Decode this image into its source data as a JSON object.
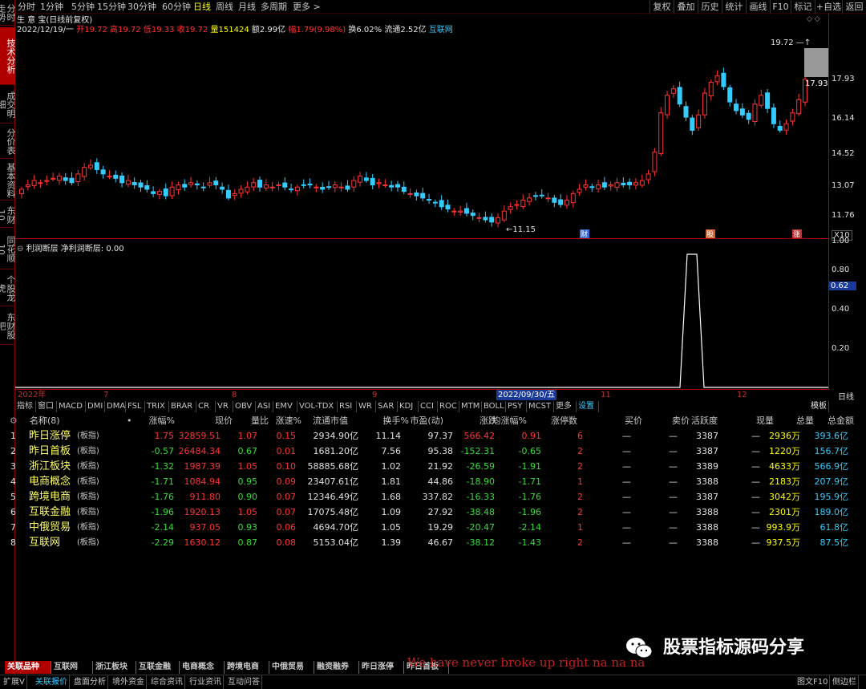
{
  "sidebar": [
    "分时走势",
    "技术分析",
    "成交明细",
    "分价表",
    "基本资料",
    "东财10",
    "同花顺10",
    "个股龙虎",
    "东财股吧"
  ],
  "topbar": {
    "periods": [
      "分时",
      "1分钟",
      "5分钟",
      "15分钟",
      "30分钟",
      "60分钟",
      "日线",
      "周线",
      "月线",
      "多周期",
      "更多 >"
    ],
    "active": "日线",
    "right": [
      "复权",
      "叠加",
      "历史",
      "统计",
      "画线",
      "F10",
      "标记",
      "+自选",
      "返回"
    ]
  },
  "chart_header": {
    "title": "生 意 宝(日线前复权)",
    "date": "2022/12/19/一",
    "open_label": "开19.72",
    "high_label": "高19.72",
    "low_label": "低19.33",
    "close_label": "收19.72",
    "vol_label": "量151424",
    "amt_label": "额2.99亿",
    "chg_label": "幅1.79(9.98%)",
    "turn_label": "换6.02%",
    "float_label": "流通2.52亿",
    "sector": "互联网"
  },
  "price_axis": [
    "17.93",
    "16.14",
    "14.52",
    "13.07",
    "11.76"
  ],
  "price_current": "17.93",
  "price_hi_mark": "19.72",
  "price_lo_mark": "11.15",
  "xscale": "X10",
  "markers": [
    "财",
    "股",
    "涨"
  ],
  "indicator": {
    "title": "利润断层",
    "line_label": "净利润断层: 0.00",
    "axis": [
      "1.00",
      "0.80",
      "0.62",
      "0.40",
      "0.20"
    ],
    "current": "0.62"
  },
  "date_axis": [
    "2022年",
    "7",
    "8",
    "9",
    "2022/09/30/五",
    "11",
    "12"
  ],
  "date_axis_right": "日线",
  "indicator_tabs": [
    "指标",
    "窗口",
    "MACD",
    "DMI",
    "DMA",
    "FSL",
    "TRIX",
    "BRAR",
    "CR",
    "VR",
    "OBV",
    "ASI",
    "EMV",
    "VOL-TDX",
    "RSI",
    "WR",
    "SAR",
    "KDJ",
    "CCI",
    "ROC",
    "MTM",
    "BOLL",
    "PSY",
    "MCST",
    "更多",
    "设置"
  ],
  "indicator_tabs_right": "模板",
  "table": {
    "headers": [
      "名称(8)",
      "•",
      "涨幅%",
      "现价",
      "量比",
      "涨速%",
      "流通市值",
      "换手%",
      "市盈(动)",
      "涨跌",
      "均涨幅%",
      "涨停数",
      "买价",
      "卖价",
      "活跃度",
      "现量",
      "总量",
      "总金额"
    ],
    "rows": [
      {
        "no": "1",
        "name": "昨日涨停",
        "tag": "(板指)",
        "chg": "1.75",
        "price": "32859.51",
        "vr": "1.07",
        "spd": "0.15",
        "mcap": "2934.90亿",
        "turn": "11.14",
        "pe": "97.37",
        "diff": "566.42",
        "avg": "0.91",
        "lim": "6",
        "buy": "—",
        "sell": "—",
        "act": "3387",
        "cur": "—",
        "vol": "2936万",
        "amt": "393.6亿",
        "up": true
      },
      {
        "no": "2",
        "name": "昨日首板",
        "tag": "(板指)",
        "chg": "-0.57",
        "price": "26484.34",
        "vr": "0.67",
        "spd": "0.01",
        "mcap": "1681.20亿",
        "turn": "7.56",
        "pe": "95.38",
        "diff": "-152.31",
        "avg": "-0.65",
        "lim": "2",
        "buy": "—",
        "sell": "—",
        "act": "3387",
        "cur": "—",
        "vol": "1220万",
        "amt": "156.7亿",
        "up": false
      },
      {
        "no": "3",
        "name": "浙江板块",
        "tag": "(板指)",
        "chg": "-1.32",
        "price": "1987.39",
        "vr": "1.05",
        "spd": "0.10",
        "mcap": "58885.68亿",
        "turn": "1.02",
        "pe": "21.92",
        "diff": "-26.59",
        "avg": "-1.91",
        "lim": "2",
        "buy": "—",
        "sell": "—",
        "act": "3389",
        "cur": "—",
        "vol": "4633万",
        "amt": "566.9亿",
        "up": false
      },
      {
        "no": "4",
        "name": "电商概念",
        "tag": "(板指)",
        "chg": "-1.71",
        "price": "1084.94",
        "vr": "0.95",
        "spd": "0.09",
        "mcap": "23407.61亿",
        "turn": "1.81",
        "pe": "44.86",
        "diff": "-18.90",
        "avg": "-1.71",
        "lim": "1",
        "buy": "—",
        "sell": "—",
        "act": "3388",
        "cur": "—",
        "vol": "2183万",
        "amt": "207.9亿",
        "up": false
      },
      {
        "no": "5",
        "name": "跨境电商",
        "tag": "(板指)",
        "chg": "-1.76",
        "price": "911.80",
        "vr": "0.90",
        "spd": "0.07",
        "mcap": "12346.49亿",
        "turn": "1.68",
        "pe": "337.82",
        "diff": "-16.33",
        "avg": "-1.76",
        "lim": "2",
        "buy": "—",
        "sell": "—",
        "act": "3387",
        "cur": "—",
        "vol": "3042万",
        "amt": "195.9亿",
        "up": false
      },
      {
        "no": "6",
        "name": "互联金融",
        "tag": "(板指)",
        "chg": "-1.96",
        "price": "1920.13",
        "vr": "1.05",
        "spd": "0.07",
        "mcap": "17075.48亿",
        "turn": "1.09",
        "pe": "27.92",
        "diff": "-38.48",
        "avg": "-1.96",
        "lim": "2",
        "buy": "—",
        "sell": "—",
        "act": "3388",
        "cur": "—",
        "vol": "2301万",
        "amt": "189.0亿",
        "up": false
      },
      {
        "no": "7",
        "name": "中俄贸易",
        "tag": "(板指)",
        "chg": "-2.14",
        "price": "937.05",
        "vr": "0.93",
        "spd": "0.06",
        "mcap": "4694.70亿",
        "turn": "1.05",
        "pe": "19.29",
        "diff": "-20.47",
        "avg": "-2.14",
        "lim": "1",
        "buy": "—",
        "sell": "—",
        "act": "3388",
        "cur": "—",
        "vol": "993.9万",
        "amt": "61.8亿",
        "up": false
      },
      {
        "no": "8",
        "name": "互联网",
        "tag": "(板指)",
        "chg": "-2.29",
        "price": "1630.12",
        "vr": "0.87",
        "spd": "0.08",
        "mcap": "5153.04亿",
        "turn": "1.39",
        "pe": "46.67",
        "diff": "-38.12",
        "avg": "-1.43",
        "lim": "2",
        "buy": "—",
        "sell": "—",
        "act": "3388",
        "cur": "—",
        "vol": "937.5万",
        "amt": "87.5亿",
        "up": false
      }
    ]
  },
  "bottom_tabs": [
    "关联品种",
    "互联网",
    "浙江板块",
    "互联金融",
    "电商概念",
    "跨境电商",
    "中俄贸易",
    "融资融券",
    "昨日涨停",
    "昨日首板"
  ],
  "overlay_text": "We have never broke up right na na na",
  "watermark": "股票指标源码分享",
  "status": [
    "扩展V",
    "关联报价",
    "盘面分析",
    "境外资金",
    "综合资讯",
    "行业资讯",
    "互动问答"
  ],
  "status_right": [
    "图文F10",
    "侧边栏"
  ],
  "colors": {
    "up": "#ff3333",
    "down": "#33dd33",
    "accent": "#ffff00",
    "border": "#a00000"
  }
}
